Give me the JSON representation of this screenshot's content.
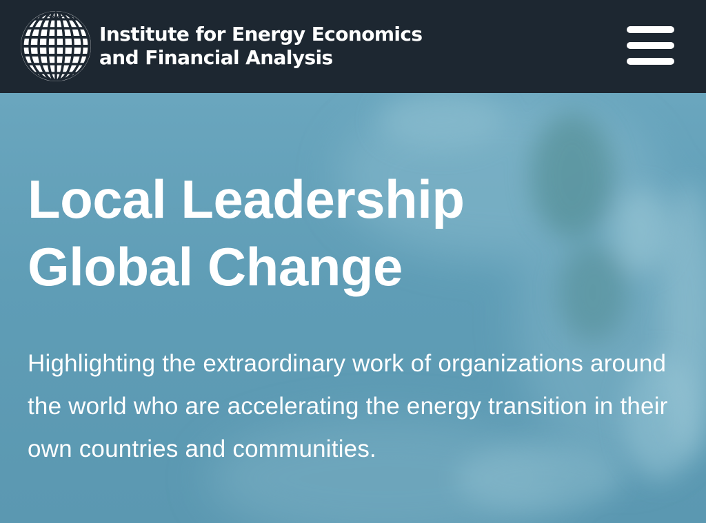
{
  "header": {
    "brand": {
      "line1": "Institute for Energy Economics",
      "line2": "and Financial Analysis",
      "logo_icon": "globe-grid-icon"
    },
    "menu_icon": "hamburger-menu-icon",
    "background_color": "#1d2731"
  },
  "hero": {
    "title_line1": "Local Leadership",
    "title_line2": "Global Change",
    "subtitle": "Highlighting the extraordinary work of organizations around the world who are accelerating the energy transition in their own countries and communities.",
    "background_color": "#5f9cb5"
  }
}
